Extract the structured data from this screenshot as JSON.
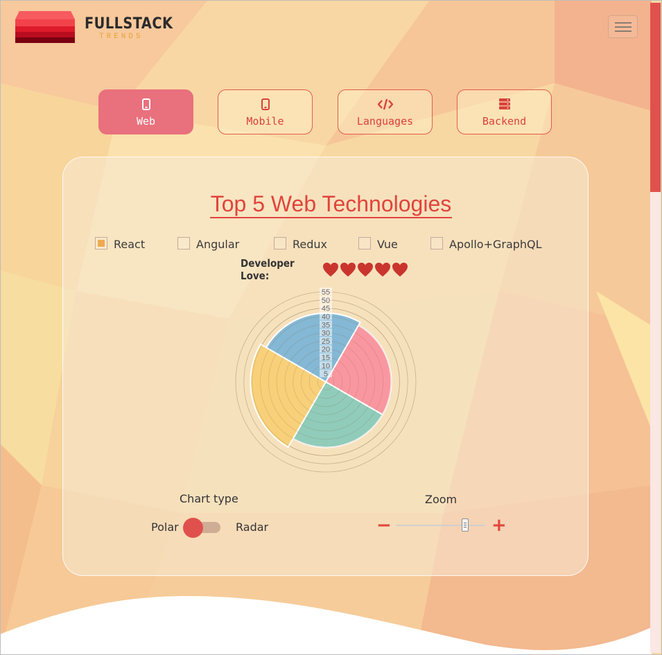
{
  "logo": {
    "title": "FULLSTACK",
    "subtitle": "TRENDS"
  },
  "menu": {
    "icon": "hamburger-menu-icon"
  },
  "tabs": [
    {
      "label": "Web",
      "icon": "mobile-phone-icon",
      "active": true
    },
    {
      "label": "Mobile",
      "icon": "mobile-phone-icon",
      "active": false
    },
    {
      "label": "Languages",
      "icon": "code-icon",
      "active": false
    },
    {
      "label": "Backend",
      "icon": "server-icon",
      "active": false
    }
  ],
  "card": {
    "title": "Top 5 Web Technologies",
    "technologies": [
      {
        "label": "React",
        "checked": true
      },
      {
        "label": "Angular",
        "checked": false
      },
      {
        "label": "Redux",
        "checked": false
      },
      {
        "label": "Vue",
        "checked": false
      },
      {
        "label": "Apollo+GraphQL",
        "checked": false
      }
    ],
    "developer_love": {
      "label": "Developer Love:",
      "rating": 5,
      "max": 5,
      "icon": "heart-icon"
    }
  },
  "chart_data": {
    "type": "polar",
    "radial_ticks": [
      "5",
      "10",
      "15",
      "20",
      "25",
      "30",
      "35",
      "40",
      "45",
      "50",
      "55"
    ],
    "r_max": 55,
    "slices": [
      {
        "value": 40,
        "color": "#f98a9b"
      },
      {
        "value": 40,
        "color": "#7ec8b8"
      },
      {
        "value": 46,
        "color": "#f7cd6d"
      },
      {
        "value": 42,
        "color": "#70b0d8"
      }
    ]
  },
  "controls": {
    "chart_type": {
      "label": "Chart type",
      "left": "Polar",
      "right": "Radar",
      "selected": "Polar"
    },
    "zoom": {
      "label": "Zoom",
      "minus": "−",
      "plus": "+",
      "value": 0.8
    }
  },
  "colors": {
    "accent": "#e0443c",
    "active_tab": "#e9707d",
    "background": "#f7d79e"
  }
}
